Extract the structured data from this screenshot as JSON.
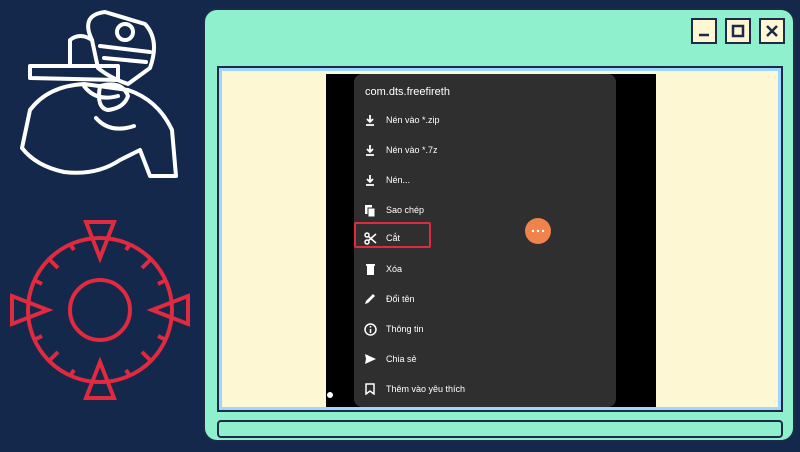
{
  "decorations": {
    "left_top": "paintball-player-icon",
    "left_bottom": "crosshair-icon"
  },
  "window": {
    "controls": [
      {
        "name": "minimize",
        "icon": "minimize-icon"
      },
      {
        "name": "maximize",
        "icon": "maximize-icon"
      },
      {
        "name": "close",
        "icon": "close-icon"
      }
    ]
  },
  "menu": {
    "title": "com.dts.freefireth",
    "items": [
      {
        "label": "Nén vào *.zip",
        "icon": "download-icon"
      },
      {
        "label": "Nén vào *.7z",
        "icon": "download-icon"
      },
      {
        "label": "Nén...",
        "icon": "download-icon"
      },
      {
        "label": "Sao chép",
        "icon": "copy-icon"
      },
      {
        "label": "Cắt",
        "icon": "scissors-icon"
      },
      {
        "label": "Xóa",
        "icon": "trash-icon"
      },
      {
        "label": "Đổi tên",
        "icon": "pencil-icon"
      },
      {
        "label": "Thông tin",
        "icon": "info-icon"
      },
      {
        "label": "Chia sẻ",
        "icon": "send-icon"
      },
      {
        "label": "Thêm vào yêu thích",
        "icon": "bookmark-icon"
      }
    ]
  },
  "colors": {
    "background": "#14284b",
    "window": "#8ff0cd",
    "content": "#fef7d3",
    "frame": "#9fd6ff",
    "menu": "#2f2f2f",
    "highlight": "#e02a3f",
    "accent": "#f0824b",
    "art_stroke_light": "#ffffff",
    "art_stroke_red": "#e02a3f"
  }
}
